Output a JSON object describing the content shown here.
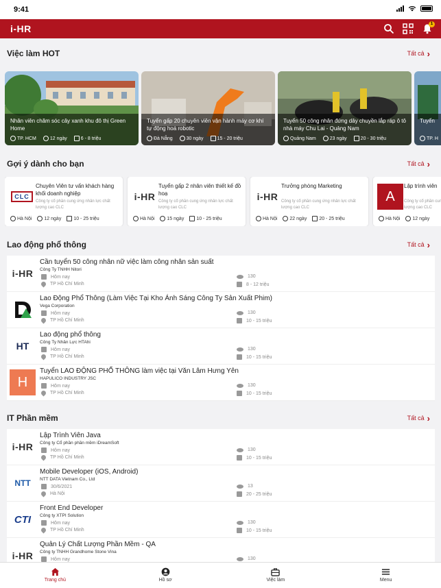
{
  "status": {
    "time": "9:41"
  },
  "app": {
    "logo_text": "i-HR",
    "notification_count": "1"
  },
  "hot": {
    "title": "Việc làm HOT",
    "see_all": "Tất cả",
    "cards": [
      {
        "title": "Nhân viên chăm sóc cây xanh khu đô thị Green Home",
        "location": "TP. HCM",
        "duration": "12 ngày",
        "salary": "6 - 8 triệu"
      },
      {
        "title": "Tuyển gấp 20 chuyên viên vận hành máy cơ khí tự động hoá robotic",
        "location": "Đà Nẵng",
        "duration": "30 ngày",
        "salary": "15 - 20 triệu"
      },
      {
        "title": "Tuyển 50 công nhân đứng dây chuyền lắp ráp ô tô nhà máy Chu Lai - Quảng Nam",
        "location": "Quảng Nam",
        "duration": "23 ngày",
        "salary": "20 - 30 triệu"
      },
      {
        "title": "Tuyển",
        "location": "TP. H",
        "duration": "",
        "salary": ""
      }
    ]
  },
  "suggest": {
    "title": "Gợi ý dành cho bạn",
    "see_all": "Tất cả",
    "cards": [
      {
        "logo": "CLC",
        "title": "Chuyên Viên tư vấn khách hàng khối doanh nghiệp",
        "company": "Công ty cổ phần cung ứng nhân lực chất lượng cao CLC",
        "location": "Hà Nội",
        "duration": "12 ngày",
        "salary": "10 - 25 triệu"
      },
      {
        "logo": "i-HR",
        "title": "Tuyển gấp 2 nhân viên thiết kế đồ hoạ",
        "company": "Công ty cổ phần cung ứng nhân lực chất lượng cao CLC",
        "location": "Hà Nội",
        "duration": "15 ngày",
        "salary": "10 - 25 triệu"
      },
      {
        "logo": "i-HR",
        "title": "Trưởng phòng Marketing",
        "company": "Công ty cổ phần cung ứng nhân lực chất lượng cao CLC",
        "location": "Hà Nội",
        "duration": "22 ngày",
        "salary": "20 - 25 triệu"
      },
      {
        "logo": "A",
        "title": "Lập trình viên",
        "company": "Công ty cổ phần cung ứng nhân lực chất lượng cao CLC",
        "location": "Hà Nội",
        "duration": "12 ngày",
        "salary": ""
      }
    ]
  },
  "labor": {
    "title": "Lao động phổ thông",
    "see_all": "Tất cả",
    "items": [
      {
        "logo": "i-HR",
        "title": "Cần tuyển 50 công nhân nữ việc làm công nhân sản suất",
        "company": "Công Ty TNHH Nitori",
        "date": "Hôm nay",
        "location": "TP Hồ Chí Minh",
        "views": "130",
        "salary": "8 - 12 triệu"
      },
      {
        "logo": "DA",
        "title": "Lao Động Phổ Thông (Làm Việc Tại Kho Ánh Sáng Công Ty Sản Xuất Phim)",
        "company": "Vega Corporation",
        "date": "Hôm nay",
        "location": "TP Hồ Chí Minh",
        "views": "130",
        "salary": "10 - 15 triệu"
      },
      {
        "logo": "HT",
        "title": "Lao động phổ thông",
        "company": "Công Ty Nhân Lực HTAhi",
        "date": "Hôm nay",
        "location": "TP Hồ Chí Minh",
        "views": "130",
        "salary": "10 - 15 triệu"
      },
      {
        "logo": "H",
        "title": "Tuyển LAO ĐỘNG PHỔ THÔNG làm việc tại Văn Lâm Hưng Yên",
        "company": "HAPULICO INDUSTRY JSC",
        "date": "Hôm nay",
        "location": "TP Hồ Chí Minh",
        "views": "130",
        "salary": "10 - 15 triệu"
      }
    ]
  },
  "it": {
    "title": "IT Phần mềm",
    "see_all": "Tất cả",
    "items": [
      {
        "logo": "i-HR",
        "title": "Lập Trình Viên Java",
        "company": "Công ty Cổ phần phần mềm iDreamSoft",
        "date": "Hôm nay",
        "location": "TP Hồ Chí Minh",
        "views": "130",
        "salary": "10 - 15 triệu"
      },
      {
        "logo": "NTT",
        "title": "Mobile Developer (iOS, Android)",
        "company": "NTT DATA Vietnam Co., Ltd",
        "date": "30/6/2021",
        "location": "Hà Nội",
        "views": "13",
        "salary": "20 - 25 triệu"
      },
      {
        "logo": "CTI",
        "title": "Front End Developer",
        "company": "Công ty XTPI Solution",
        "date": "Hôm nay",
        "location": "TP Hồ Chí Minh",
        "views": "130",
        "salary": "10 - 15 triệu"
      },
      {
        "logo": "i-HR",
        "title": "Quản Lý Chất Lượng Phần Mềm - QA",
        "company": "Công ty TNHH Grandhome Stone Vina",
        "date": "Hôm nay",
        "location": "",
        "views": "130",
        "salary": ""
      }
    ]
  },
  "tabs": [
    {
      "label": "Trang chủ"
    },
    {
      "label": "Hồ sơ"
    },
    {
      "label": "Việc làm"
    },
    {
      "label": "Menu"
    }
  ],
  "colors": {
    "brand": "#b0141f",
    "background": "#f2f2f4"
  }
}
